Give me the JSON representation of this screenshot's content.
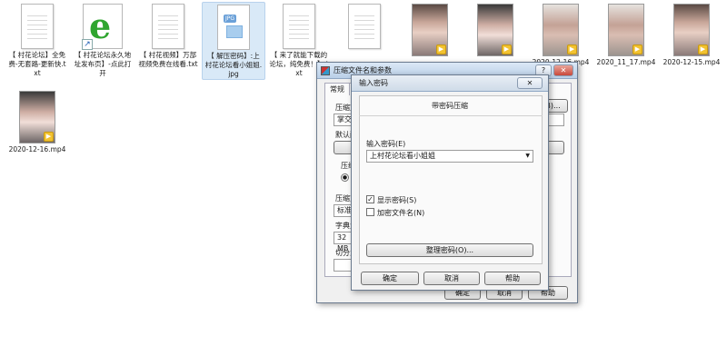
{
  "desktop": {
    "files": [
      {
        "name": "【 村花论坛】全免费-无套路-更新快.txt",
        "type": "txt"
      },
      {
        "name": "【 村花论坛永久地址发布页】-点此打开",
        "type": "url",
        "icon": "ie-icon"
      },
      {
        "name": "【 村花视频】万部视频免费在线看.txt",
        "type": "txt"
      },
      {
        "name": "【 解压密码】:上村花论坛看小姐姐.jpg",
        "type": "jpg",
        "tag": "JPG"
      },
      {
        "name": "【 来了就能下载的论坛，纯免费！】.txt",
        "type": "txt"
      },
      {
        "name": "",
        "type": "txt"
      },
      {
        "name": "",
        "type": "video"
      },
      {
        "name": "",
        "type": "video"
      },
      {
        "name": "2020-12-16.mp4",
        "type": "video"
      },
      {
        "name": "2020_11_17.mp4",
        "type": "video"
      },
      {
        "name": "2020-12-15.mp4",
        "type": "video"
      },
      {
        "name": "2020-12-16.mp4",
        "type": "video"
      }
    ]
  },
  "compress_dialog": {
    "title": "压缩文件名和参数",
    "help_btn": "?",
    "close_btn": "✕",
    "tab_general": "常规",
    "labels": [
      "压缩文",
      "掌交",
      "默认配",
      "压缩",
      "压缩方",
      "标准",
      "字典大",
      "32 MB",
      "切分为"
    ],
    "browse_btn": "(B)...",
    "ok_btn": "确定",
    "cancel_btn": "取消",
    "help_btn2": "帮助"
  },
  "password_dialog": {
    "title": "输入密码",
    "close_btn": "✕",
    "heading": "带密码压缩",
    "password_label": "输入密码(E)",
    "password_value": "上村花论坛看小姐姐",
    "show_password_label": "显示密码(S)",
    "show_password_checked": true,
    "encrypt_names_label": "加密文件名(N)",
    "encrypt_names_checked": false,
    "organize_btn": "整理密码(O)...",
    "ok_btn": "确定",
    "cancel_btn": "取消",
    "help_btn": "帮助"
  }
}
